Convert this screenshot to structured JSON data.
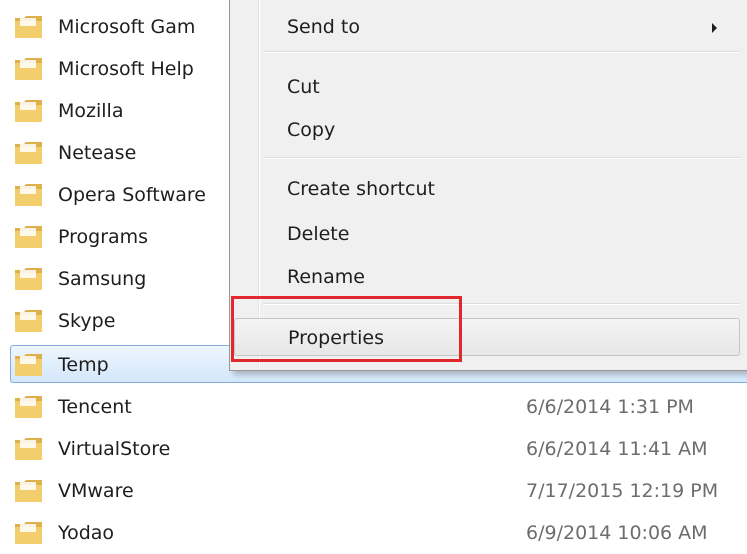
{
  "files": [
    {
      "name": "Microsoft Gam",
      "date": ""
    },
    {
      "name": "Microsoft Help",
      "date": ""
    },
    {
      "name": "Mozilla",
      "date": ""
    },
    {
      "name": "Netease",
      "date": ""
    },
    {
      "name": "Opera Software",
      "date": ""
    },
    {
      "name": "Programs",
      "date": ""
    },
    {
      "name": "Samsung",
      "date": ""
    },
    {
      "name": "Skype",
      "date": ""
    },
    {
      "name": "Temp",
      "date": "",
      "selected": true
    },
    {
      "name": "Tencent",
      "date": "6/6/2014 1:31 PM"
    },
    {
      "name": "VirtualStore",
      "date": "6/6/2014 11:41 AM"
    },
    {
      "name": "VMware",
      "date": "7/17/2015 12:19 PM"
    },
    {
      "name": "Yodao",
      "date": "6/9/2014 10:06 AM"
    }
  ],
  "context_menu": {
    "send_to": "Send to",
    "cut": "Cut",
    "copy": "Copy",
    "create_shortcut": "Create shortcut",
    "delete": "Delete",
    "rename": "Rename",
    "properties": "Properties"
  },
  "icons": {
    "folder": "folder-icon",
    "submenu": "submenu-arrow-icon"
  },
  "colors": {
    "highlight_box": "#e0282e",
    "selection": "#cce4fb",
    "folder": "#e9c25a"
  }
}
